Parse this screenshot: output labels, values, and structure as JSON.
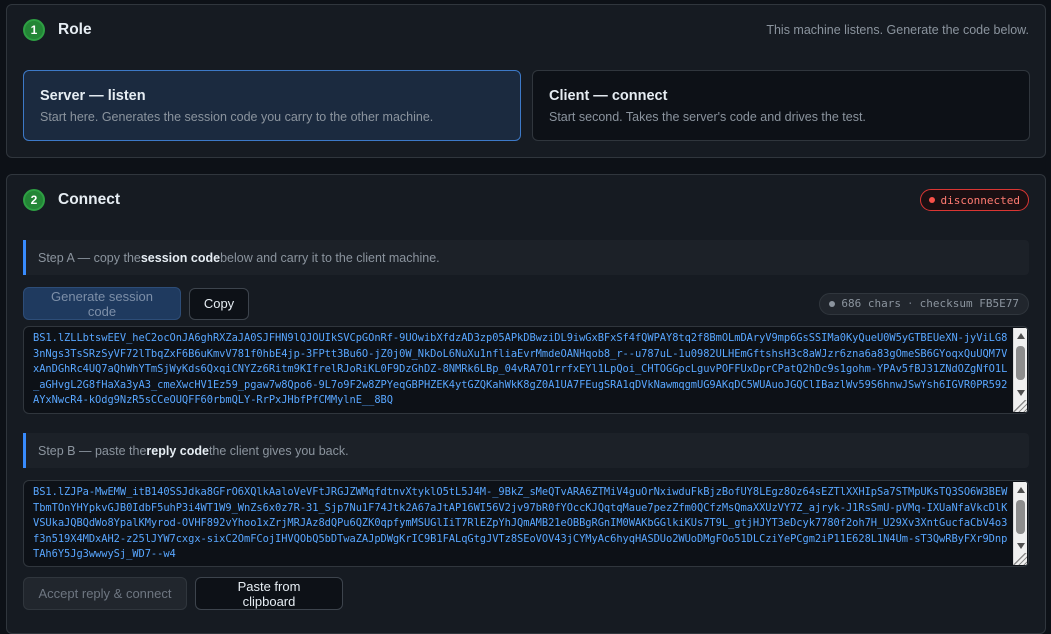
{
  "role_section": {
    "step": "1",
    "title": "Role",
    "hint": "This machine listens. Generate the code below.",
    "options": [
      {
        "title": "Server — listen",
        "description": "Start here. Generates the session code you carry to the other machine.",
        "selected": true
      },
      {
        "title": "Client — connect",
        "description": "Start second. Takes the server's code and drives the test.",
        "selected": false
      }
    ]
  },
  "connect_section": {
    "step": "2",
    "title": "Connect",
    "status": "disconnected",
    "status_color": "#f85149",
    "step_a": {
      "prefix": "Step A — copy the ",
      "emphasis": "session code",
      "suffix": " below and carry it to the client machine."
    },
    "generate_button": "Generate session code",
    "copy_button": "Copy",
    "meta": {
      "chars": "686 chars",
      "separator": "·",
      "checksum": "checksum FB5E77"
    },
    "session_code": "BS1.lZLLbtswEEV_heC2ocOnJA6ghRXZaJA0SJFHN9lQJOUIkSVCpGOnRf-9UOwibXfdzAD3zp05APkDBwziDL9iwGxBFxSf4fQWPAY8tq2f8BmOLmDAryV9mp6GsSSIMa0KyQueU0W5yGTBEUeXN-jyViLG83nNgs3TsSRzSyVF72lTbqZxF6B6uKmvV781f0hbE4jp-3FPtt3Bu6O-jZ0j0W_NkDoL6NuXu1nfliaEvrMmdeOANHqob8_r--u787uL-1u0982ULHEmGftshsH3c8aWJzr6zna6a83gOmeSB6GYoqxQuUQM7VxAnDGhRc4UQ7aQhWhYTmSjWyKds6QxqiCNYZz6Ritm9KIfrelRJoRiKL0F9DzGhDZ-8NMRk6LBp_04vRA7O1rrfxEYl1LpQoi_CHTOGGpcLguvPOFFUxDprCPatQ2hDc9s1gohm-YPAv5fBJ31ZNdOZgNfO1L_aGHvgL2G8fHaXa3yA3_cmeXwcHV1Ez59_pgaw7w8Qpo6-9L7o9F2w8ZPYeqGBPHZEK4ytGZQKahWkK8gZ0A1UA7FEugSRA1qDVkNawmqgmUG9AKqDC5WUAuoJGQClIBazlWv59S6hnwJSwYsh6IGVR0PR592AYxNwcR4-kOdg9NzR5sCCeOUQFF60rbmQLY-RrPxJHbfPfCMMylnE__8BQ",
    "step_b": {
      "prefix": "Step B — paste the ",
      "emphasis": "reply code",
      "suffix": " the client gives you back."
    },
    "reply_code": "BS1.lZJPa-MwEMW_itB140SSJdka8GFrO6XQlkAaloVeVFtJRGJZWMqfdtnvXtyklO5tL5J4M-_9BkZ_sMeQTvARA6ZTMiV4guOrNxiwduFkBjzBofUY8LEgz8Oz64sEZTlXXHIpSa7STMpUKsTQ3SO6W3BEWTbmTOnYHYpkvGJB0IdbF5uhP3i4WT1W9_WnZs6x0z7R-31_Sjp7Nu1F74Jtk2A67aJtAP16WI56V2jv97bR0fYOccKJQqtqMaue7pezZfm0QCfzMsQmaXXUzVY7Z_ajryk-J1RsSmU-pVMq-IXUaNfaVkcDlKVSUkaJQBQdWo8YpalKMyrod-OVHF892vYhoo1xZrjMRJAz8dQPu6QZK0qpfymMSUGlIiT7RlEZpYhJQmAMB21eOBBgRGnIM0WAKbGGlkiKUs7T9L_gtjHJYT3eDcyk7780f2oh7H_U29Xv3XntGucfaCbV4o3f3n519X4MDxAH2-z25lJYW7cxgx-sixC2OmFCojIHVQObQ5bDTwaZAJpDWgKrIC9B1FALqGtgJVTz8SEoVOV43jCYMyAc6hyqHASDUo2WUoDMgFOo51DLCziYePCgm2iP11E628L1N4Um-sT3QwRByFXr9DnpTAh6Y5Jg3wwwySj_WD7--w4",
    "accept_button": "Accept reply & connect",
    "paste_button": "Paste from clipboard"
  }
}
